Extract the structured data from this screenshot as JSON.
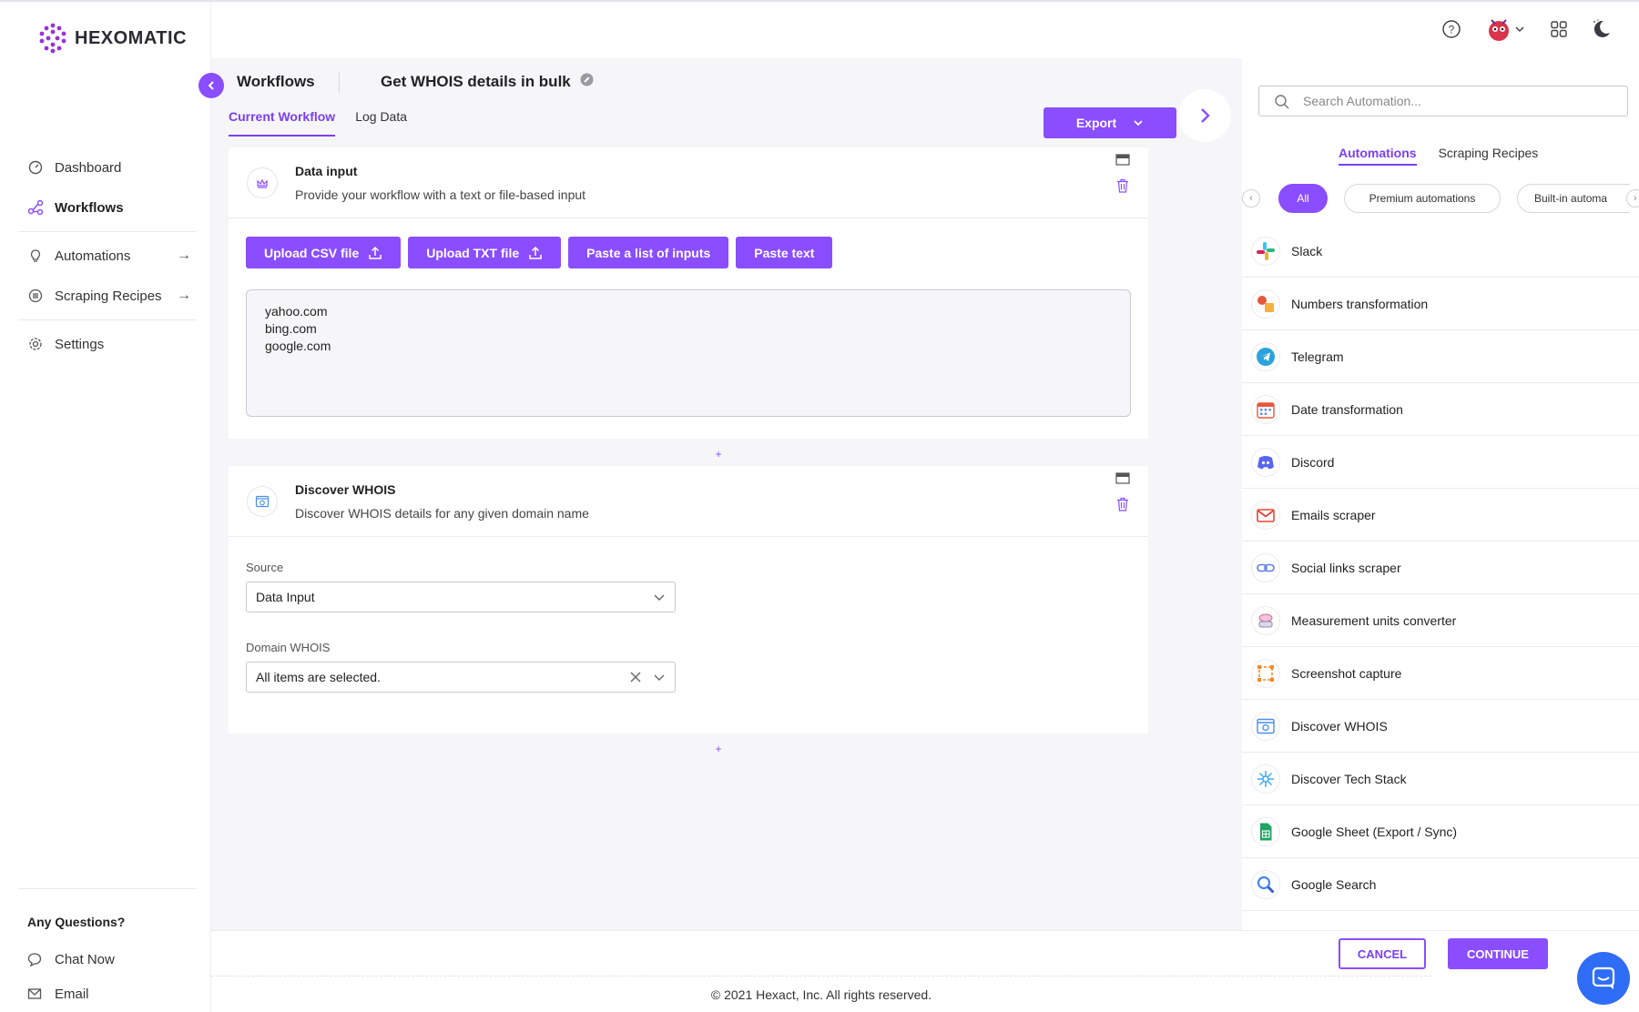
{
  "app": {
    "logo_text": "HEXOMATIC"
  },
  "sidebar": {
    "items": [
      {
        "label": "Dashboard",
        "icon": "dashboard-icon"
      },
      {
        "label": "Workflows",
        "icon": "workflows-icon",
        "active": true
      },
      {
        "label": "Automations",
        "icon": "bulb-icon"
      },
      {
        "label": "Scraping Recipes",
        "icon": "recipes-icon"
      },
      {
        "label": "Settings",
        "icon": "gear-icon"
      }
    ],
    "help_title": "Any Questions?",
    "help_items": [
      {
        "label": "Chat Now",
        "icon": "chat-icon"
      },
      {
        "label": "Email",
        "icon": "mail-icon"
      }
    ]
  },
  "header": {
    "breadcrumb": "Workflows",
    "workflow_name": "Get WHOIS details in bulk",
    "tabs": [
      "Current Workflow",
      "Log Data"
    ],
    "export_label": "Export"
  },
  "data_input": {
    "title": "Data input",
    "description": "Provide your workflow with a text or file-based input",
    "buttons": [
      "Upload CSV file",
      "Upload TXT file",
      "Paste a list of inputs",
      "Paste text"
    ],
    "text_value": "yahoo.com\nbing.com\ngoogle.com"
  },
  "discover_whois": {
    "title": "Discover WHOIS",
    "description": "Discover WHOIS details for any given domain name",
    "source_label": "Source",
    "source_value": "Data Input",
    "domain_label": "Domain WHOIS",
    "domain_value": "All items are selected."
  },
  "footer": {
    "cancel_label": "CANCEL",
    "continue_label": "CONTINUE",
    "copyright": "© 2021 Hexact, Inc. All rights reserved."
  },
  "right_panel": {
    "search_placeholder": "Search Automation...",
    "tabs": [
      "Automations",
      "Scraping Recipes"
    ],
    "filters": [
      "All",
      "Premium automations",
      "Built-in automa"
    ],
    "automations": [
      "Slack",
      "Numbers transformation",
      "Telegram",
      "Date transformation",
      "Discord",
      "Emails scraper",
      "Social links scraper",
      "Measurement units converter",
      "Screenshot capture",
      "Discover WHOIS",
      "Discover Tech Stack",
      "Google Sheet (Export / Sync)",
      "Google Search"
    ]
  },
  "colors": {
    "accent": "#8a4dff",
    "accent_text": "#7b3ff2",
    "main_bg": "#f6f6f8"
  }
}
